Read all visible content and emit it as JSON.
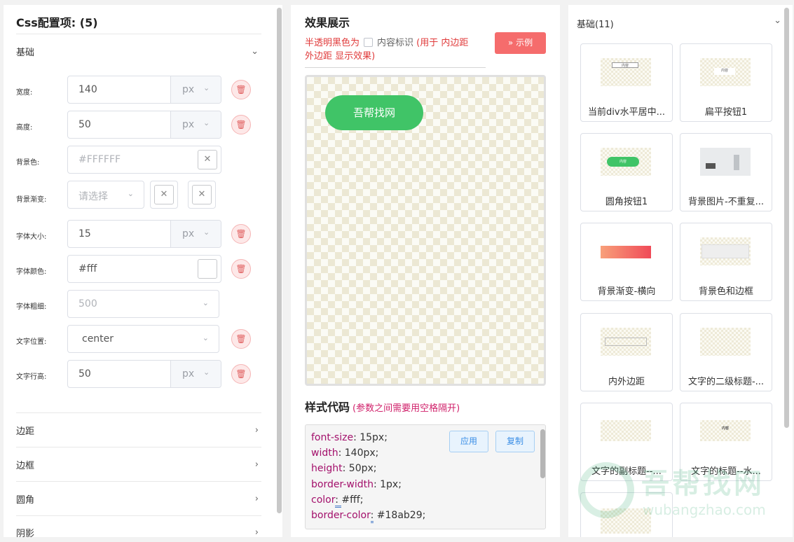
{
  "left": {
    "title": "Css配置项: (5)",
    "basic_section": "基础",
    "rows": {
      "width": {
        "label": "宽度:",
        "value": "140",
        "unit": "px"
      },
      "height": {
        "label": "高度:",
        "value": "50",
        "unit": "px"
      },
      "bg_color": {
        "label": "背景色:",
        "placeholder": "#FFFFFF"
      },
      "bg_gradient": {
        "label": "背景渐变:",
        "placeholder": "请选择"
      },
      "font_size": {
        "label": "字体大小:",
        "value": "15",
        "unit": "px"
      },
      "font_color": {
        "label": "字体颜色:",
        "value": "#fff"
      },
      "font_weight": {
        "label": "字体粗细:",
        "placeholder": "500"
      },
      "text_align": {
        "label": "文字位置:",
        "value": "center"
      },
      "line_height": {
        "label": "文字行高:",
        "value": "50",
        "unit": "px"
      }
    },
    "sections": [
      "边距",
      "边框",
      "圆角",
      "阴影"
    ]
  },
  "mid": {
    "title": "效果展示",
    "warn_prefix": "半透明黑色为",
    "content_marker": "内容标识",
    "warn_suffix_1": "(用于 内边距",
    "warn_suffix_2": "外边距 显示效果)",
    "example_button": "示例",
    "demo_button_text": "吾帮找网",
    "style_title": "样式代码",
    "style_hint": "(参数之间需要用空格隔开)",
    "apply_button": "应用",
    "copy_button": "复制",
    "code_lines": [
      {
        "key": "font-size",
        "value": " 15px;"
      },
      {
        "key": "width",
        "value": " 140px;"
      },
      {
        "key": "height",
        "value": " 50px;"
      },
      {
        "key": "border-width",
        "value": " 1px;"
      },
      {
        "key": "color",
        "value": "#fff;"
      },
      {
        "key": "border-color",
        "value": " #18ab29;"
      }
    ]
  },
  "right": {
    "title": "基础(11)",
    "cards": [
      "当前div水平居中...",
      "扁平按钮1",
      "圆角按钮1",
      "背景图片-不重复...",
      "背景渐变-横向",
      "背景色和边框",
      "内外边距",
      "文字的二级标题-...",
      "文字的副标题--...",
      "文字的标题--水..."
    ],
    "thumb_text": "内容"
  },
  "watermark": {
    "cn": "吾帮找网",
    "en": "wubangzhao.com"
  },
  "colors": {
    "accent_green": "#40c467",
    "danger": "#f56c6c",
    "code_key": "#a3106b"
  }
}
